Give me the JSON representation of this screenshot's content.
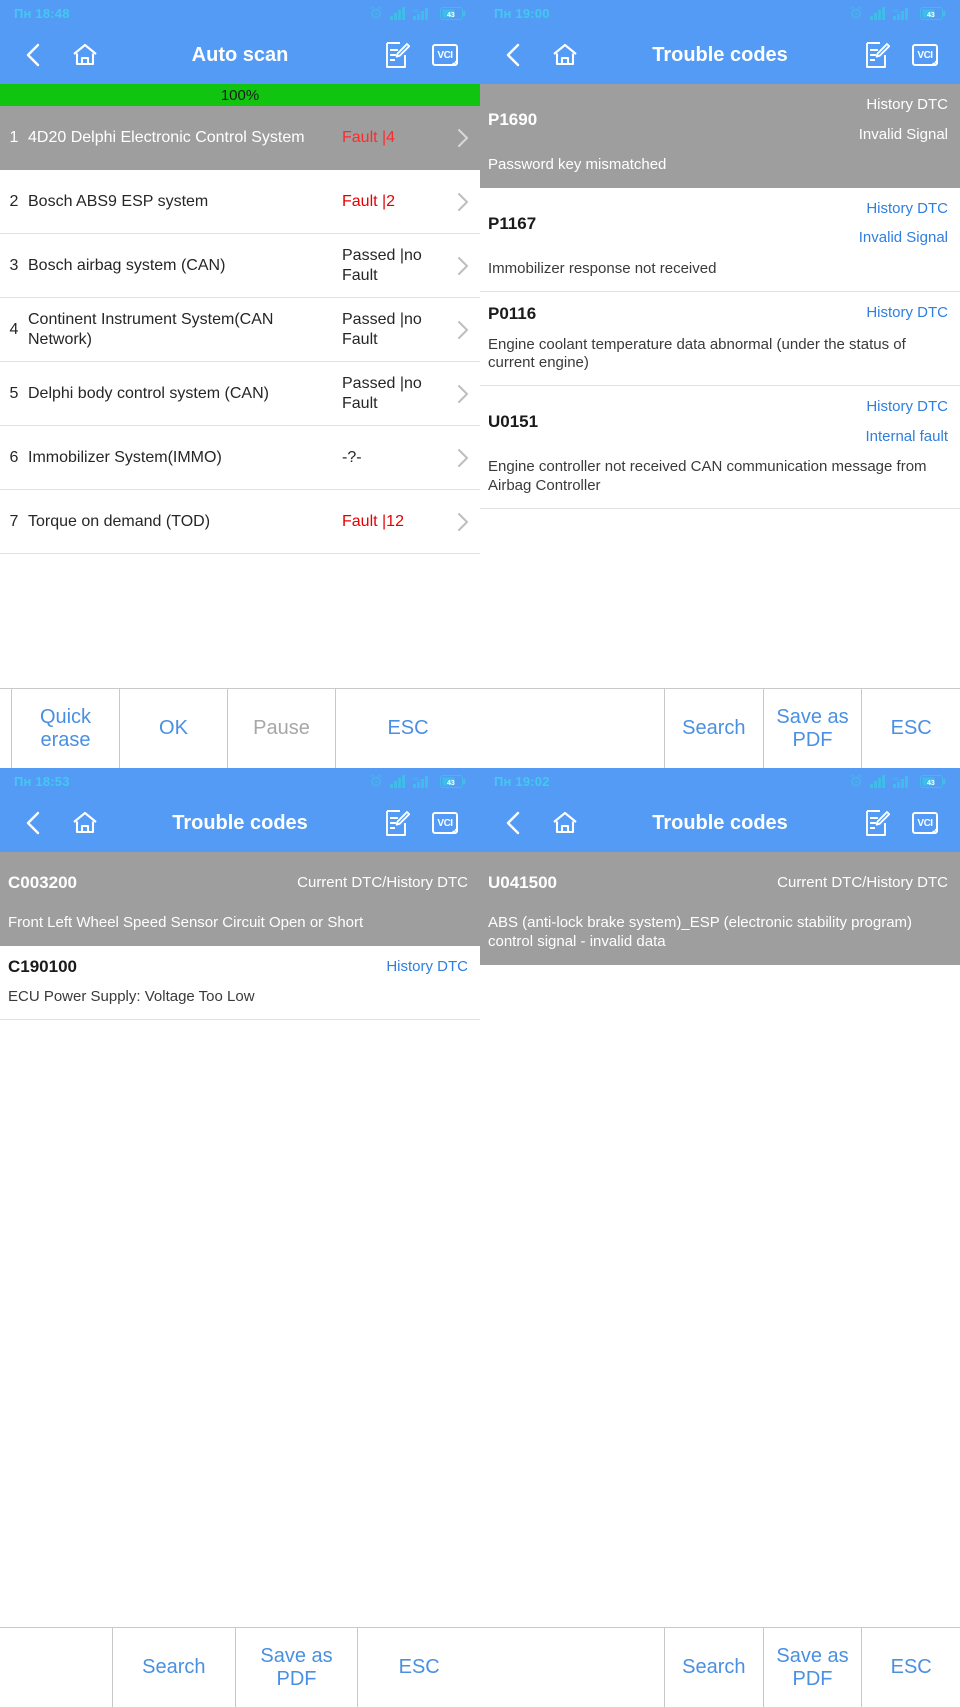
{
  "panels": {
    "top_left": {
      "status": {
        "time": "Пн 18:48",
        "battery": "43"
      },
      "title": "Auto scan",
      "progress": {
        "label": "100%",
        "percent": 100
      },
      "rows": [
        {
          "index": "1",
          "name": "4D20 Delphi Electronic Control System",
          "status": "Fault |4",
          "state": "fault",
          "selected": true
        },
        {
          "index": "2",
          "name": "Bosch ABS9 ESP system",
          "status": "Fault |2",
          "state": "fault",
          "selected": false
        },
        {
          "index": "3",
          "name": "Bosch airbag system (CAN)",
          "status": "Passed |no Fault",
          "state": "pass",
          "selected": false
        },
        {
          "index": "4",
          "name": "Continent Instrument System(CAN Network)",
          "status": "Passed |no Fault",
          "state": "pass",
          "selected": false
        },
        {
          "index": "5",
          "name": "Delphi body control system (CAN)",
          "status": "Passed |no Fault",
          "state": "pass",
          "selected": false
        },
        {
          "index": "6",
          "name": "Immobilizer System(IMMO)",
          "status": "-?-",
          "state": "unknown",
          "selected": false
        },
        {
          "index": "7",
          "name": "Torque on demand (TOD)",
          "status": "Fault |12",
          "state": "fault",
          "selected": false
        }
      ],
      "toolbar": [
        {
          "label": "",
          "state": "empty"
        },
        {
          "label": "Quick erase",
          "state": "active"
        },
        {
          "label": "OK",
          "state": "active"
        },
        {
          "label": "Pause",
          "state": "disabled"
        },
        {
          "label": "ESC",
          "state": "active"
        }
      ]
    },
    "top_right": {
      "status": {
        "time": "Пн 19:00",
        "battery": "43"
      },
      "title": "Trouble codes",
      "rows": [
        {
          "code": "P1690",
          "tags": [
            "History DTC",
            "Invalid Signal"
          ],
          "desc": "Password key mismatched",
          "selected": true
        },
        {
          "code": "P1167",
          "tags": [
            "History DTC",
            "Invalid Signal"
          ],
          "desc": "Immobilizer response not received",
          "selected": false
        },
        {
          "code": "P0116",
          "tags": [
            "History DTC"
          ],
          "desc": "Engine coolant temperature data abnormal (under the status of current engine)",
          "selected": false
        },
        {
          "code": "U0151",
          "tags": [
            "History DTC",
            "Internal fault"
          ],
          "desc": "Engine controller not received CAN communication message from Airbag Controller",
          "selected": false
        }
      ],
      "toolbar": [
        {
          "label": "",
          "state": "empty"
        },
        {
          "label": "Search",
          "state": "active"
        },
        {
          "label": "Save as PDF",
          "state": "active"
        },
        {
          "label": "ESC",
          "state": "active"
        }
      ]
    },
    "bottom_left": {
      "status": {
        "time": "Пн 18:53",
        "battery": "43"
      },
      "title": "Trouble codes",
      "rows": [
        {
          "code": "C003200",
          "tags": [
            "Current DTC/History DTC"
          ],
          "desc": "Front Left Wheel Speed Sensor Circuit Open or Short",
          "selected": true
        },
        {
          "code": "C190100",
          "tags": [
            "History DTC"
          ],
          "desc": "ECU Power Supply: Voltage Too Low",
          "selected": false
        }
      ],
      "toolbar": [
        {
          "label": "",
          "state": "empty"
        },
        {
          "label": "Search",
          "state": "active"
        },
        {
          "label": "Save as PDF",
          "state": "active"
        },
        {
          "label": "ESC",
          "state": "active"
        }
      ]
    },
    "bottom_right": {
      "status": {
        "time": "Пн 19:02",
        "battery": "43"
      },
      "title": "Trouble codes",
      "rows": [
        {
          "code": "U041500",
          "tags": [
            "Current DTC/History DTC"
          ],
          "desc": "ABS (anti-lock brake system)_ESP (electronic stability program) control signal - invalid data",
          "selected": true
        }
      ],
      "toolbar": [
        {
          "label": "",
          "state": "empty"
        },
        {
          "label": "Search",
          "state": "active"
        },
        {
          "label": "Save as PDF",
          "state": "active"
        },
        {
          "label": "ESC",
          "state": "active"
        }
      ]
    }
  },
  "icons": {
    "back": "chevron-left-icon",
    "home": "home-icon",
    "edit": "edit-note-icon",
    "vci": "VCI",
    "alarm": "alarm-clock-icon",
    "signal": "signal-bars-icon",
    "network": "4g-signal-icon",
    "battery": "battery-icon",
    "chevron": "chevron-right-icon"
  },
  "colors": {
    "accent": "#539bf5",
    "progress": "#10c410",
    "fault": "#e60000",
    "selected_row": "#9e9e9e",
    "link": "#4a90e2",
    "tag": "#2f7fe0"
  }
}
